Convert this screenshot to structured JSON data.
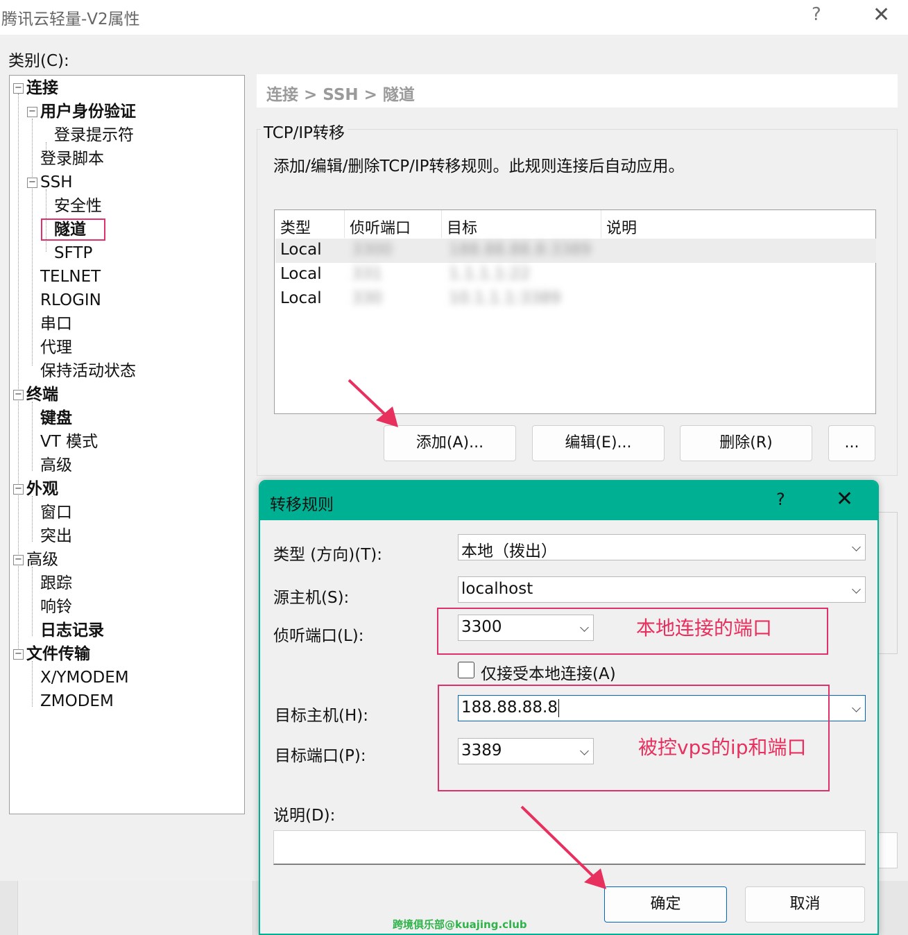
{
  "window": {
    "title": "腾讯云轻量-V2属性",
    "help_label": "?",
    "close_label": "✕"
  },
  "category_label": "类别(C):",
  "tree": {
    "connection": "连接",
    "auth": "用户身份验证",
    "login_prompt": "登录提示符",
    "login_script": "登录脚本",
    "ssh": "SSH",
    "security": "安全性",
    "tunnel": "隧道",
    "sftp": "SFTP",
    "telnet": "TELNET",
    "rlogin": "RLOGIN",
    "serial": "串口",
    "proxy": "代理",
    "keepalive": "保持活动状态",
    "terminal": "终端",
    "keyboard": "键盘",
    "vt_mode": "VT 模式",
    "advanced_term": "高级",
    "appearance": "外观",
    "window": "窗口",
    "highlight": "突出",
    "advanced": "高级",
    "trace": "跟踪",
    "bell": "响铃",
    "logging": "日志记录",
    "file_transfer": "文件传输",
    "xymodem": "X/YMODEM",
    "zmodem": "ZMODEM",
    "expander_symbol": "−"
  },
  "breadcrumb": "连接 > SSH > 隧道",
  "forwarding": {
    "group_title": "TCP/IP转移",
    "description": "添加/编辑/删除TCP/IP转移规则。此规则连接后自动应用。",
    "columns": [
      "类型",
      "侦听端口",
      "目标",
      "说明"
    ],
    "rows": [
      {
        "type": "Local",
        "port": "3300",
        "target": "188.88.88.8:3389"
      },
      {
        "type": "Local",
        "port": "331",
        "target": "1.1.1.1:22"
      },
      {
        "type": "Local",
        "port": "330",
        "target": "10.1.1.1:3389"
      }
    ],
    "buttons": {
      "add": "添加(A)...",
      "edit": "编辑(E)...",
      "delete": "删除(R)",
      "more": "..."
    }
  },
  "dialog": {
    "title": "转移规则",
    "help_label": "?",
    "close_label": "✕",
    "type_label": "类型 (方向)(T):",
    "type_value": "本地（拨出）",
    "source_label": "源主机(S):",
    "source_value": "localhost",
    "listen_label": "侦听端口(L):",
    "listen_value": "3300",
    "local_only_label": "仅接受本地连接(A)",
    "target_host_label": "目标主机(H):",
    "target_host_value": "188.88.88.8",
    "target_port_label": "目标端口(P):",
    "target_port_value": "3389",
    "desc_label": "说明(D):",
    "desc_value": "",
    "ok": "确定",
    "cancel": "取消"
  },
  "annotations": {
    "local_port_note": "本地连接的端口",
    "target_note": "被控vps的ip和端口",
    "color": "#e0306a"
  },
  "watermark": "跨境俱乐部@kuajing.club"
}
